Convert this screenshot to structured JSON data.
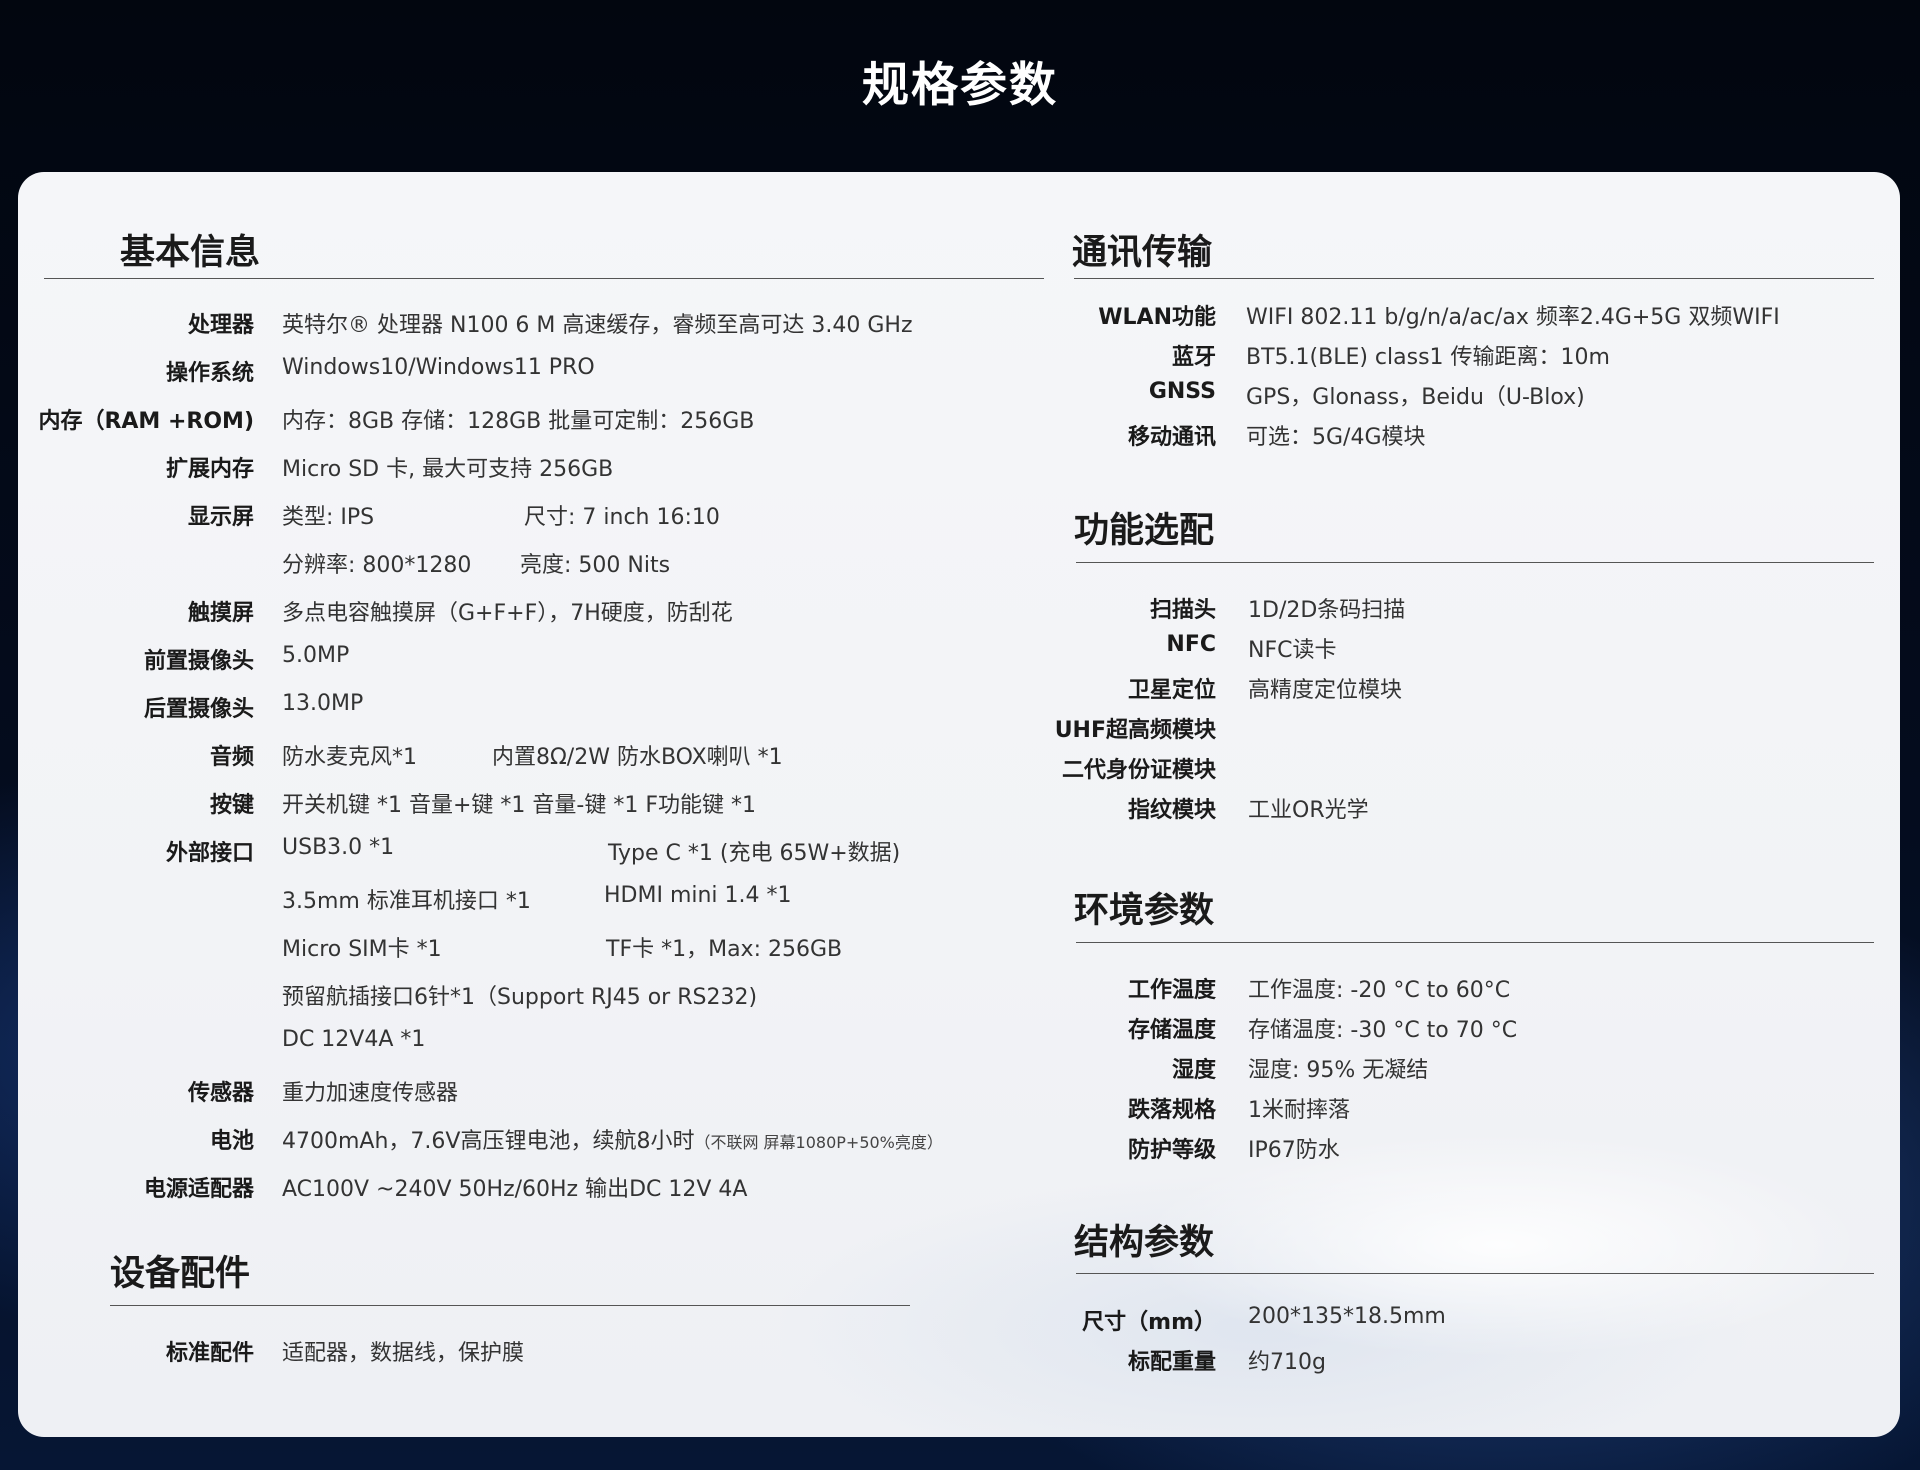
{
  "page_title": "规格参数",
  "basic": {
    "title": "基本信息",
    "rows": [
      {
        "label": "处理器",
        "cols": [
          "英特尔® 处理器 N100 6 M 高速缓存，睿频至高可达 3.40 GHz"
        ]
      },
      {
        "label": "操作系统",
        "cols": [
          "Windows10/Windows11 PRO"
        ]
      },
      {
        "label": "内存（RAM +ROM)",
        "cols": [
          "内存：8GB  存储：128GB    批量可定制：256GB"
        ]
      },
      {
        "label": "扩展内存",
        "cols": [
          "Micro SD 卡, 最大可支持 256GB"
        ]
      },
      {
        "label": "显示屏",
        "cols": [
          "类型: IPS",
          "尺寸: 7 inch  16:10"
        ]
      },
      {
        "label": "",
        "cols": [
          "分辨率:  800*1280",
          "亮度: 500 Nits"
        ]
      },
      {
        "label": "触摸屏",
        "cols": [
          "多点电容触摸屏（G+F+F），7H硬度，防刮花"
        ]
      },
      {
        "label": "前置摄像头",
        "cols": [
          "5.0MP"
        ]
      },
      {
        "label": "后置摄像头",
        "cols": [
          "13.0MP"
        ]
      },
      {
        "label": "音频",
        "cols": [
          "防水麦克风*1",
          "内置8Ω/2W 防水BOX喇叭 *1"
        ]
      },
      {
        "label": "按键",
        "cols": [
          "开关机键 *1    音量+键 *1    音量-键 *1    F功能键 *1"
        ]
      },
      {
        "label": "外部接口",
        "cols": [
          "USB3.0 *1",
          "Type C *1 (充电 65W+数据)"
        ]
      },
      {
        "label": "",
        "cols": [
          "3.5mm 标准耳机接口  *1",
          "HDMI mini 1.4 *1"
        ]
      },
      {
        "label": "",
        "cols": [
          "Micro SIM卡  *1",
          "TF卡 *1，Max: 256GB"
        ]
      },
      {
        "label": "",
        "cols": [
          "预留航插接口6针*1（Support RJ45 or RS232)"
        ]
      },
      {
        "label": "",
        "cols": [
          "DC 12V4A *1"
        ]
      },
      {
        "label": "传感器",
        "cols": [
          "重力加速度传感器"
        ]
      },
      {
        "label": "电池",
        "cols": [
          "4700mAh，7.6V高压锂电池，续航8小时"
        ],
        "note": "（不联网 屏幕1080P+50%亮度）"
      },
      {
        "label": "电源适配器",
        "cols": [
          "AC100V ~240V 50Hz/60Hz   输出DC 12V 4A"
        ]
      }
    ]
  },
  "accessories": {
    "title": "设备配件",
    "rows": [
      {
        "label": "标准配件",
        "cols": [
          "适配器，数据线，保护膜"
        ]
      }
    ]
  },
  "comm": {
    "title": "通讯传输",
    "rows": [
      {
        "label": "WLAN功能",
        "cols": [
          "WIFI 802.11 b/g/n/a/ac/ax  频率2.4G+5G 双频WIFI"
        ]
      },
      {
        "label": "蓝牙",
        "cols": [
          "BT5.1(BLE) class1 传输距离：10m"
        ]
      },
      {
        "label": "GNSS",
        "cols": [
          "GPS，Glonass，Beidu（U-Blox)"
        ]
      },
      {
        "label": "移动通讯",
        "cols": [
          "可选：5G/4G模块"
        ]
      }
    ]
  },
  "options": {
    "title": "功能选配",
    "rows": [
      {
        "label": "扫描头",
        "cols": [
          "1D/2D条码扫描"
        ]
      },
      {
        "label": "NFC",
        "cols": [
          "NFC读卡"
        ]
      },
      {
        "label": "卫星定位",
        "cols": [
          "高精度定位模块"
        ]
      },
      {
        "label": "UHF超高频模块",
        "cols": [
          ""
        ]
      },
      {
        "label": "二代身份证模块",
        "cols": [
          ""
        ]
      },
      {
        "label": "指纹模块",
        "cols": [
          "工业OR光学"
        ]
      }
    ]
  },
  "env": {
    "title": "环境参数",
    "rows": [
      {
        "label": "工作温度",
        "cols": [
          "工作温度: -20 °C to 60°C"
        ]
      },
      {
        "label": "存储温度",
        "cols": [
          "存储温度: -30 °C to 70 °C"
        ]
      },
      {
        "label": "湿度",
        "cols": [
          "湿度: 95% 无凝结"
        ]
      },
      {
        "label": "跌落规格",
        "cols": [
          "1米耐摔落"
        ]
      },
      {
        "label": "防护等级",
        "cols": [
          "IP67防水"
        ]
      }
    ]
  },
  "structure": {
    "title": "结构参数",
    "rows": [
      {
        "label": "尺寸（mm）",
        "cols": [
          "200*135*18.5mm"
        ]
      },
      {
        "label": "标配重量",
        "cols": [
          "约710g"
        ]
      }
    ]
  }
}
